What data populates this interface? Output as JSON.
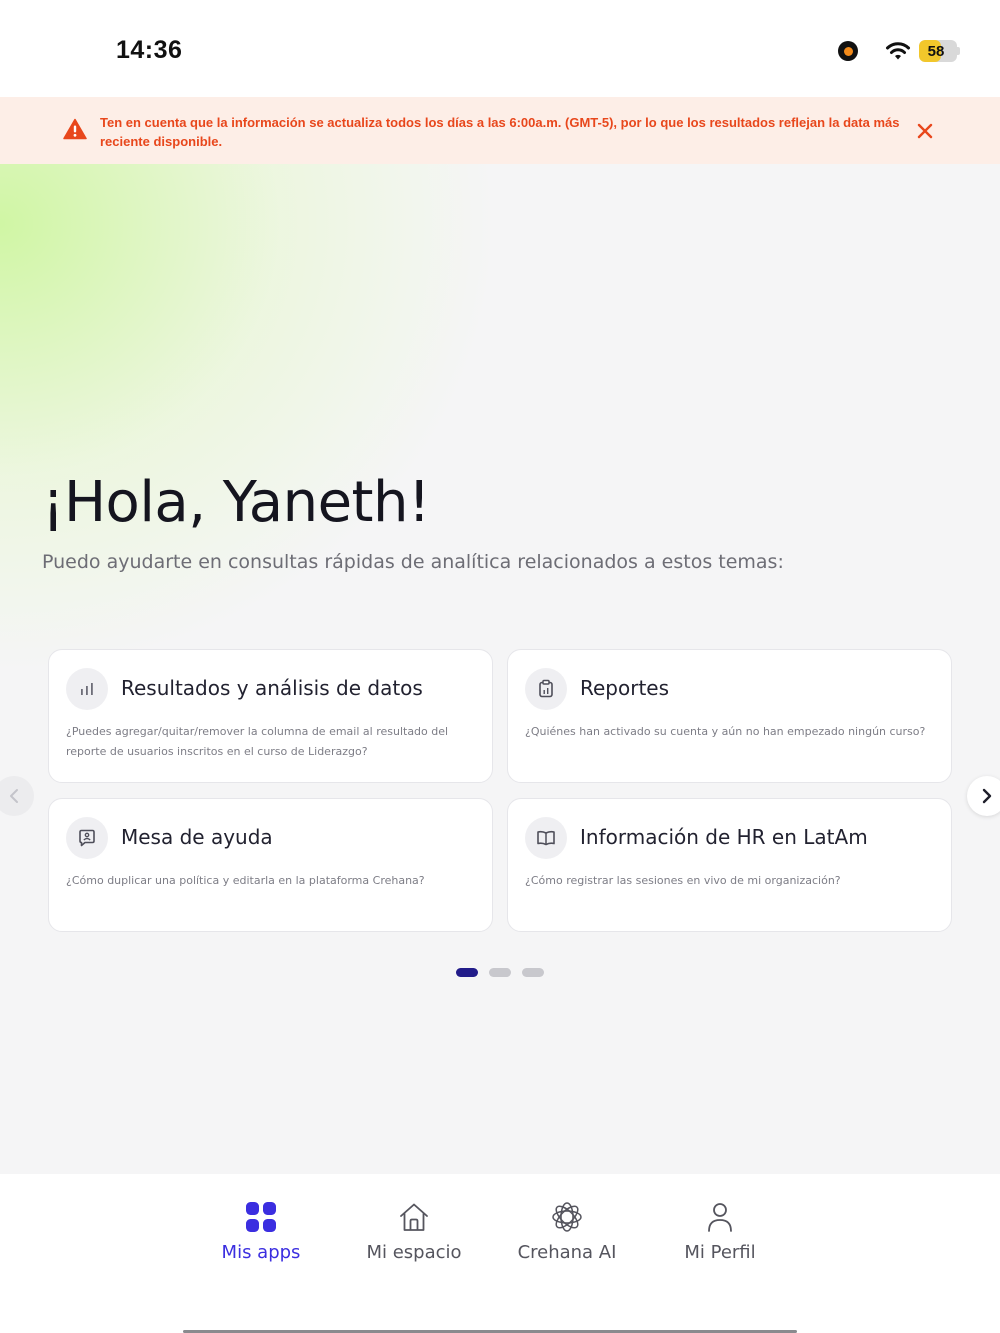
{
  "status_bar": {
    "time": "14:36",
    "battery_level": "58",
    "battery_fraction": 0.58,
    "icons": [
      "recording-dot-icon",
      "wifi-icon",
      "battery-icon"
    ]
  },
  "alert": {
    "message": "Ten en cuenta que la información se actualiza todos los días a las 6:00a.m. (GMT-5), por lo que los resultados reflejan la data más reciente disponible.",
    "icon": "warning-icon",
    "close_icon": "close-icon",
    "color": "#e8471c",
    "background": "#fdeee7"
  },
  "hero": {
    "greeting": "¡Hola, Yaneth!",
    "subtitle": "Puedo ayudarte en consultas rápidas de analítica relacionados a estos temas:"
  },
  "cards": [
    {
      "title": "Resultados y análisis de datos",
      "description": "¿Puedes agregar/quitar/remover la columna de email al resultado del reporte de usuarios inscritos en el curso de Liderazgo?",
      "icon": "bar-chart-icon"
    },
    {
      "title": "Reportes",
      "description": "¿Quiénes han activado su cuenta y aún no han empezado ningún curso?",
      "icon": "clipboard-icon"
    },
    {
      "title": "Mesa de ayuda",
      "description": "¿Cómo duplicar una política y editarla en la plataforma Crehana?",
      "icon": "support-chat-icon"
    },
    {
      "title": "Información de HR en LatAm",
      "description": "¿Cómo registrar las sesiones en vivo de mi organización?",
      "icon": "book-icon"
    }
  ],
  "carousel": {
    "pages": 3,
    "active_page": 1,
    "prev_icon": "chevron-left-icon",
    "next_icon": "chevron-right-icon"
  },
  "tabbar": {
    "active_color": "#3b2ee0",
    "tabs": [
      {
        "label": "Mis apps",
        "icon": "apps-grid-icon",
        "active": true
      },
      {
        "label": "Mi espacio",
        "icon": "home-icon",
        "active": false
      },
      {
        "label": "Crehana AI",
        "icon": "ai-flower-icon",
        "active": false
      },
      {
        "label": "Mi Perfil",
        "icon": "user-icon",
        "active": false
      }
    ]
  }
}
